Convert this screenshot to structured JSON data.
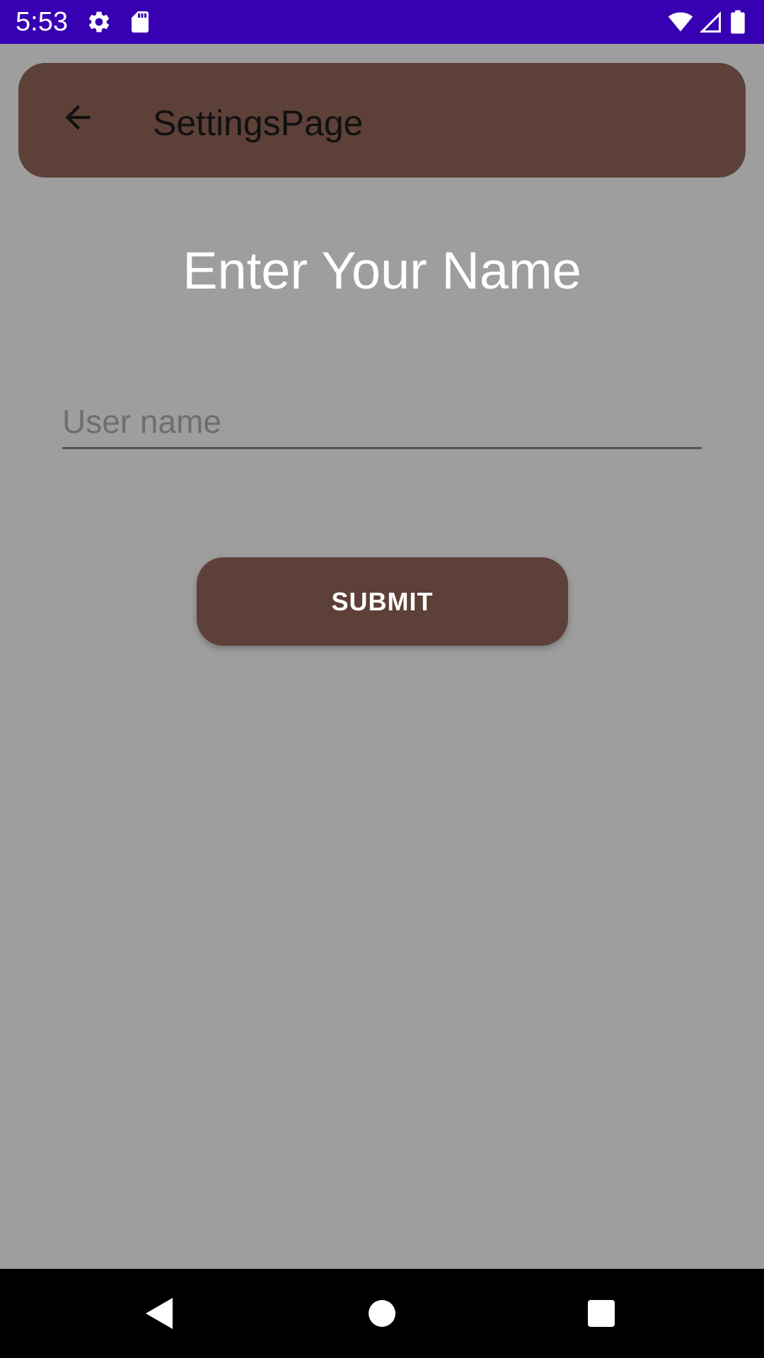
{
  "status_bar": {
    "time": "5:53",
    "background": "#3700b3",
    "icons_left": [
      "gear-icon",
      "sd-card-icon"
    ],
    "icons_right": [
      "wifi-icon",
      "cellular-signal-icon",
      "battery-icon"
    ]
  },
  "app_bar": {
    "title": "SettingsPage",
    "back_icon": "arrow-left-icon",
    "background": "#5d4037"
  },
  "main": {
    "heading": "Enter Your Name",
    "username_field": {
      "placeholder": "User name",
      "value": ""
    },
    "submit_label": "SUBMIT"
  },
  "nav_bar": {
    "buttons": [
      "back-triangle-icon",
      "home-circle-icon",
      "recents-square-icon"
    ]
  },
  "colors": {
    "page_background": "#9e9e9e",
    "accent": "#5d4037",
    "status_bar": "#3700b3"
  }
}
